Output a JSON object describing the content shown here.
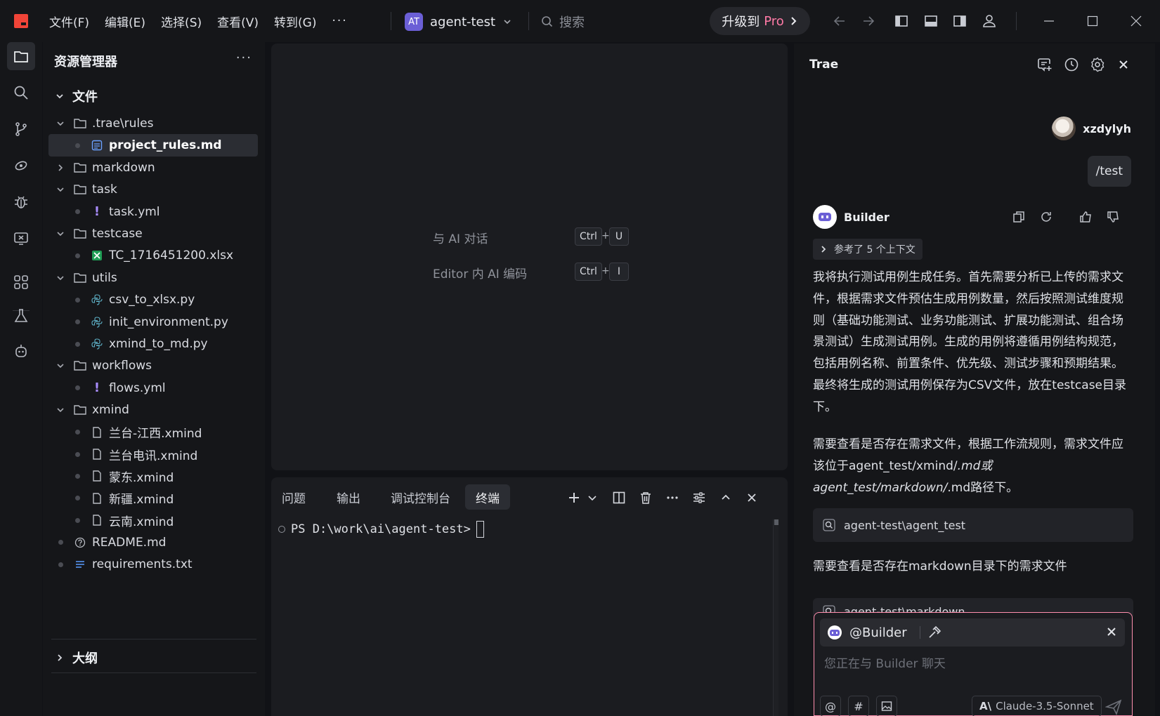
{
  "menu": [
    "文件(F)",
    "编辑(E)",
    "选择(S)",
    "查看(V)",
    "转到(G)"
  ],
  "menu_more": "···",
  "project": {
    "badge": "AT",
    "name": "agent-test"
  },
  "search": {
    "placeholder": "搜索"
  },
  "upgrade": {
    "label": "升级到",
    "pro": "Pro"
  },
  "explorer": {
    "title": "资源管理器",
    "more": "···",
    "section": "文件",
    "outline": "大纲",
    "items": [
      {
        "label": ".trae\\rules",
        "kind": "folder",
        "open": true
      },
      {
        "label": "project_rules.md",
        "kind": "rules",
        "selected": true
      },
      {
        "label": "markdown",
        "kind": "folder",
        "open": false
      },
      {
        "label": "task",
        "kind": "folder",
        "open": true
      },
      {
        "label": "task.yml",
        "kind": "yml"
      },
      {
        "label": "testcase",
        "kind": "folder",
        "open": true
      },
      {
        "label": "TC_1716451200.xlsx",
        "kind": "excel"
      },
      {
        "label": "utils",
        "kind": "folder",
        "open": true
      },
      {
        "label": "csv_to_xlsx.py",
        "kind": "py"
      },
      {
        "label": "init_environment.py",
        "kind": "py"
      },
      {
        "label": "xmind_to_md.py",
        "kind": "py"
      },
      {
        "label": "workflows",
        "kind": "folder",
        "open": true
      },
      {
        "label": "flows.yml",
        "kind": "yml"
      },
      {
        "label": "xmind",
        "kind": "folder",
        "open": true
      },
      {
        "label": "兰台-江西.xmind",
        "kind": "file"
      },
      {
        "label": "兰台电讯.xmind",
        "kind": "file"
      },
      {
        "label": "蒙东.xmind",
        "kind": "file"
      },
      {
        "label": "新疆.xmind",
        "kind": "file"
      },
      {
        "label": "云南.xmind",
        "kind": "file"
      },
      {
        "label": "README.md",
        "kind": "readme"
      },
      {
        "label": "requirements.txt",
        "kind": "txt"
      }
    ]
  },
  "editor": {
    "hint1": "与 AI 对话",
    "hint1_keys": [
      "Ctrl",
      "U"
    ],
    "hint2": "Editor 内 AI 编码",
    "hint2_keys": [
      "Ctrl",
      "I"
    ],
    "plus": "+"
  },
  "panel": {
    "tabs": [
      "问题",
      "输出",
      "调试控制台",
      "终端"
    ],
    "active_tab": "终端",
    "prompt": "PS D:\\work\\ai\\agent-test>"
  },
  "chat": {
    "title": "Trae",
    "user": "xzdylyh",
    "user_msg": "/test",
    "bot": "Builder",
    "context_pill": "参考了 5 个上下文",
    "p1": "我将执行测试用例生成任务。首先需要分析已上传的需求文件，根据需求文件预估生成用例数量，然后按照测试维度规则（基础功能测试、业务功能测试、扩展功能测试、组合场景测试）生成测试用例。生成的用例将遵循用例结构规范，包括用例名称、前置条件、优先级、测试步骤和预期结果。最终将生成的测试用例保存为CSV文件，放在testcase目录下。",
    "p2_a": "需要查看是否存在需求文件，根据工作流规则，需求文件应该位于agent_test/xmind/",
    "p2_b": ".md或agent_test/markdown/",
    "p2_c": ".md路径下。",
    "tool1": "agent-test\\agent_test",
    "p3": "需要查看是否存在markdown目录下的需求文件",
    "tool2": "agent-test\\markdown",
    "input_agent": "@Builder",
    "input_placeholder": "您正在与 Builder 聊天",
    "btn_at": "@",
    "btn_hash": "#",
    "model": "Claude-3.5-Sonnet",
    "model_logo": "A\\"
  }
}
